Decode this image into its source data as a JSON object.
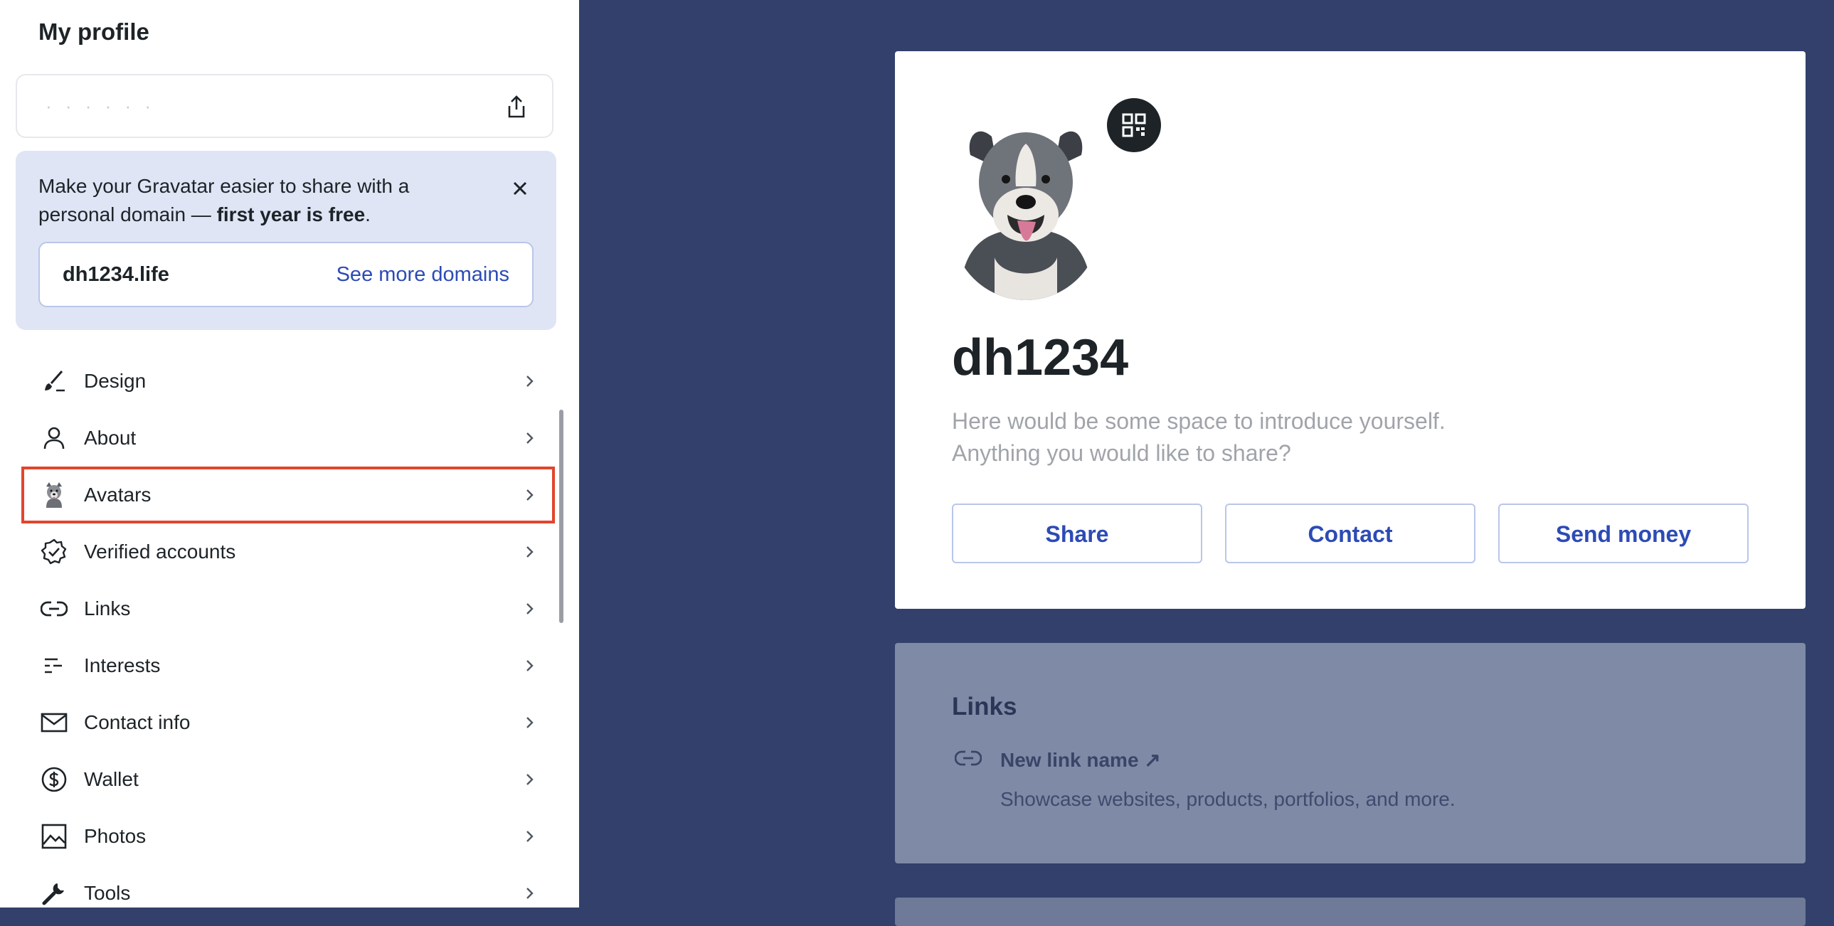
{
  "sidebar": {
    "title": "My profile",
    "url_masked": "· · · · · ·",
    "promo": {
      "text_before": "Make your Gravatar easier to share with a personal domain — ",
      "text_bold": "first year is free",
      "text_after": ".",
      "domain": "dh1234.life",
      "see_more": "See more domains"
    },
    "items": [
      {
        "label": "Design",
        "icon": "brush-icon"
      },
      {
        "label": "About",
        "icon": "person-icon"
      },
      {
        "label": "Avatars",
        "icon": "avatar-thumbnail"
      },
      {
        "label": "Verified accounts",
        "icon": "verified-badge-icon"
      },
      {
        "label": "Links",
        "icon": "link-icon"
      },
      {
        "label": "Interests",
        "icon": "interests-icon"
      },
      {
        "label": "Contact info",
        "icon": "mail-icon"
      },
      {
        "label": "Wallet",
        "icon": "dollar-icon"
      },
      {
        "label": "Photos",
        "icon": "image-icon"
      },
      {
        "label": "Tools",
        "icon": "wrench-icon"
      }
    ],
    "highlighted_item": "Avatars"
  },
  "profile": {
    "name": "dh1234",
    "bio_line1": "Here would be some space to introduce yourself.",
    "bio_line2": "Anything you would like to share?",
    "buttons": [
      "Share",
      "Contact",
      "Send money"
    ]
  },
  "links_section": {
    "title": "Links",
    "link_name": "New link name ↗",
    "link_desc": "Showcase websites, products, portfolios, and more."
  },
  "colors": {
    "background": "#32406b",
    "accent": "#2c4bb5",
    "highlight": "#e2452d",
    "promo_bg": "#dfe5f5"
  }
}
